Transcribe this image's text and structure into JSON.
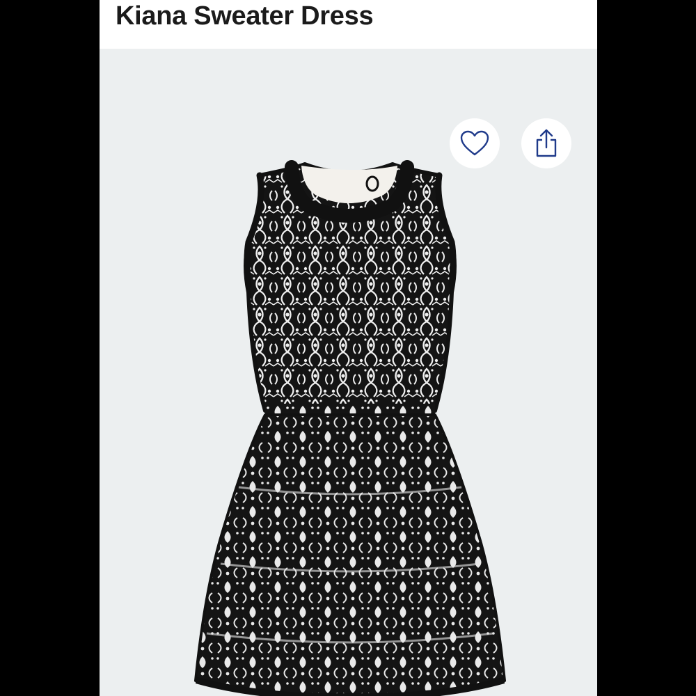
{
  "product": {
    "title": "Kiana Sweater Dress"
  },
  "actions": {
    "favorite_icon": "heart-outline-icon",
    "share_icon": "share-upload-icon",
    "icon_color": "#1f3a8a"
  },
  "image": {
    "description_icon": "dress-photo",
    "dress_colors": [
      "#141414",
      "#f2f2f2"
    ],
    "background": "#eceff0"
  }
}
